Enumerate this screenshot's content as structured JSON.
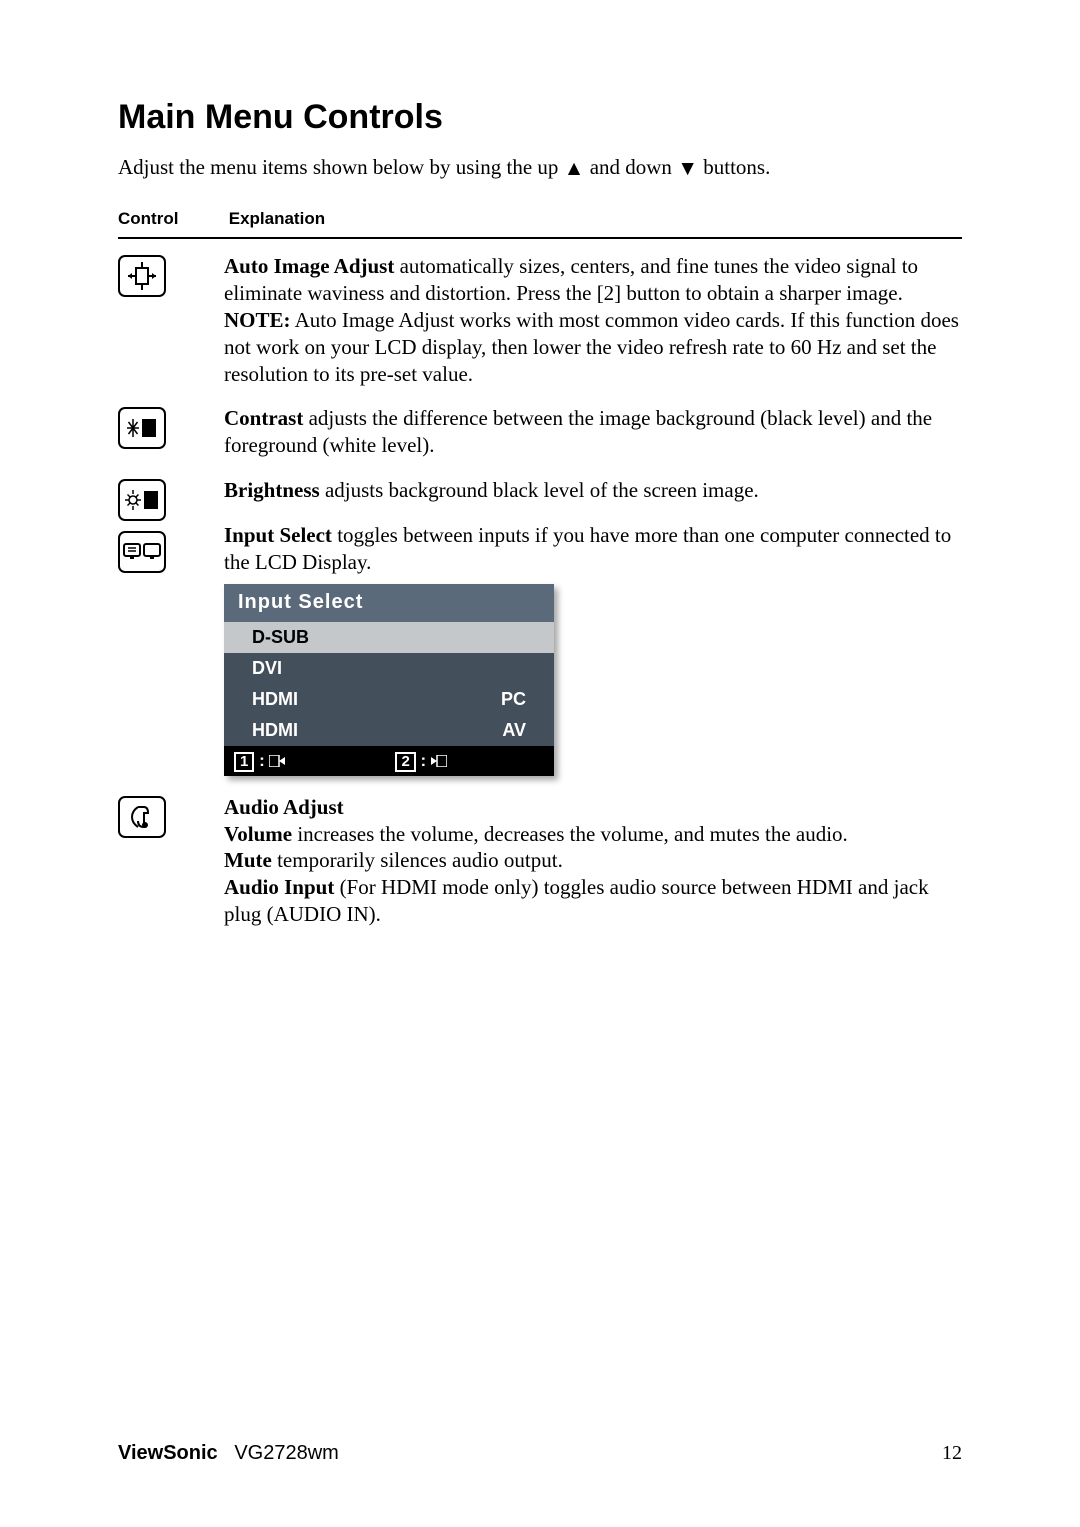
{
  "title": "Main Menu Controls",
  "intro_pre": "Adjust the menu items shown below by using the up ",
  "intro_mid": " and down ",
  "intro_post": " buttons.",
  "headers": {
    "control": "Control",
    "explanation": "Explanation"
  },
  "auto_image": {
    "bold": "Auto Image Adjust",
    "text1": " automatically sizes, centers, and fine tunes the video signal to eliminate waviness and distortion. Press the [2] button to obtain a sharper image.",
    "note_label": "NOTE:",
    "note_text": " Auto Image Adjust works with most common video cards. If this function does not work on your LCD display, then lower the video refresh rate to 60 Hz and set the resolution to its pre-set value."
  },
  "contrast": {
    "bold": "Contrast",
    "text": " adjusts the difference between the image background  (black level) and the foreground (white level)."
  },
  "brightness": {
    "bold": "Brightness",
    "text": " adjusts background black level of the screen image."
  },
  "input_select": {
    "bold": "Input Select",
    "text": " toggles between inputs if you have more than one computer connected to the LCD Display."
  },
  "osd": {
    "title": "Input Select",
    "rows": [
      {
        "left": "D-SUB",
        "right": "",
        "selected": true
      },
      {
        "left": "DVI",
        "right": "",
        "selected": false
      },
      {
        "left": "HDMI",
        "right": "PC",
        "selected": false
      },
      {
        "left": "HDMI",
        "right": "AV",
        "selected": false
      }
    ],
    "footer_1": "1",
    "footer_2": "2"
  },
  "audio": {
    "title_bold": "Audio Adjust",
    "volume_bold": "Volume",
    "volume_text": " increases the volume, decreases the volume, and mutes the audio.",
    "mute_bold": "Mute",
    "mute_text": " temporarily silences audio output.",
    "input_bold": "Audio Input",
    "input_text": " (For HDMI mode only) toggles audio source between HDMI and jack plug (AUDIO IN)."
  },
  "footer": {
    "brand_bold": "ViewSonic",
    "model": "VG2728wm",
    "page": "12"
  }
}
